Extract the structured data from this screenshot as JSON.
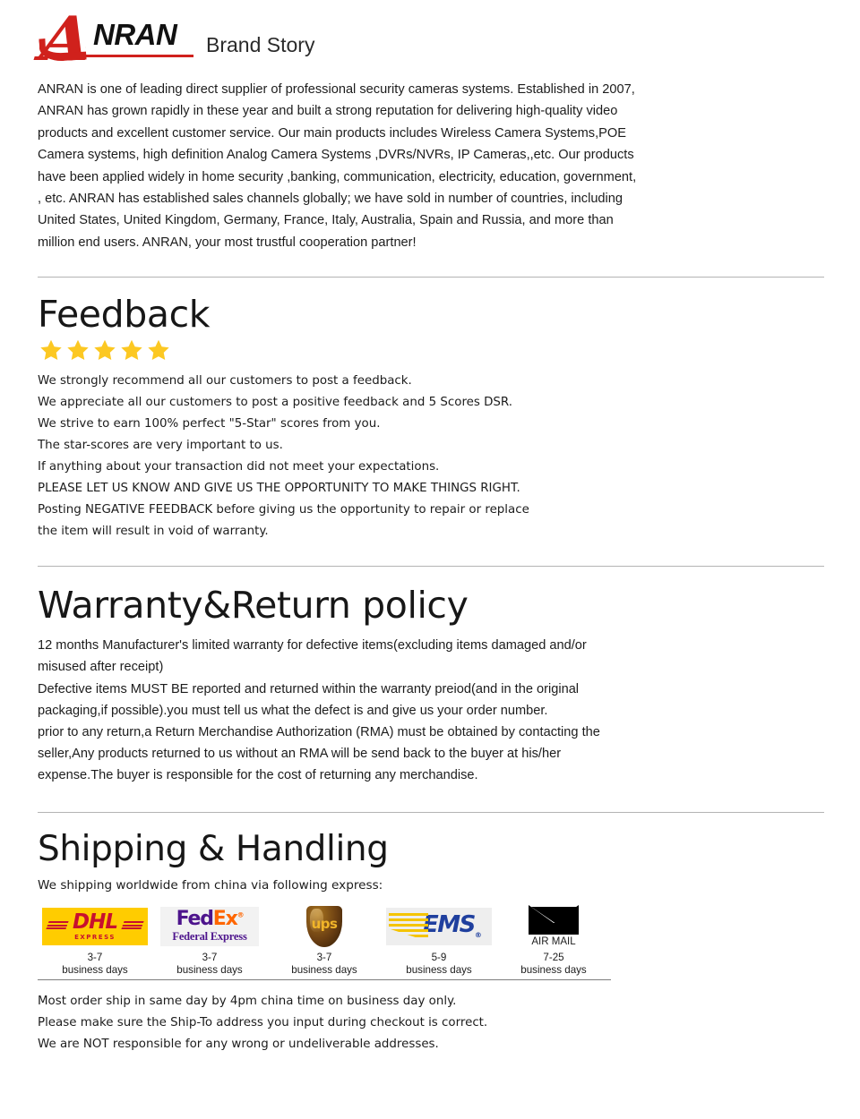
{
  "brand": {
    "logo_letter": "A",
    "logo_word": "NRAN",
    "title": "Brand Story"
  },
  "story": {
    "lines": [
      "ANRAN is one of leading direct supplier of professional security cameras systems. Established in 2007,",
      "ANRAN has grown rapidly in these year and built a strong reputation for delivering high-quality video",
      "products and excellent customer service. Our main products includes Wireless Camera Systems,POE",
      "Camera systems, high definition Analog Camera Systems ,DVRs/NVRs, IP Cameras,,etc. Our products",
      "have been applied widely in home security ,banking, communication, electricity, education, government,",
      ", etc. ANRAN has established sales channels globally; we have sold in number of countries, including",
      "United States, United Kingdom, Germany, France, Italy, Australia, Spain and Russia, and more than",
      "million end users. ANRAN, your most trustful cooperation partner!"
    ]
  },
  "feedback": {
    "heading": "Feedback",
    "star_count": 5,
    "star_color": "#fcc822",
    "lines": [
      "We strongly recommend all our customers to post a feedback.",
      "We appreciate all our customers to post a positive feedback and 5 Scores DSR.",
      "We strive to earn 100% perfect \"5-Star\" scores from you.",
      "The star-scores are very important to us.",
      "If anything about your transaction did not meet your expectations.",
      "PLEASE LET US KNOW AND GIVE US THE OPPORTUNITY TO MAKE THINGS RIGHT.",
      "Posting NEGATIVE FEEDBACK before giving us the opportunity to repair or replace",
      "the item will result in void of warranty."
    ]
  },
  "warranty": {
    "heading": "Warranty&Return policy",
    "lines": [
      "12 months Manufacturer's limited warranty for defective items(excluding items damaged and/or",
      "misused after receipt)",
      "Defective items MUST BE reported and returned within the warranty preiod(and in the original",
      "packaging,if possible).you must tell us what the defect is and give us your order number.",
      "prior to any return,a Return Merchandise Authorization (RMA) must be obtained by contacting the",
      "seller,Any products returned to us without an RMA will be send back to the buyer at his/her",
      "expense.The buyer is responsible for the cost of returning any merchandise."
    ]
  },
  "shipping": {
    "heading": "Shipping & Handling",
    "intro": "We shipping worldwide from china via following express:",
    "carriers": [
      {
        "name": "DHL",
        "logo": "dhl-logo",
        "word": "DHL",
        "sub": "EXPRESS",
        "days": "3-7",
        "days_unit": "business days"
      },
      {
        "name": "FedEx",
        "logo": "fedex-logo",
        "word_a": "Fed",
        "word_b": "Ex",
        "sub": "Federal Express",
        "days": "3-7",
        "days_unit": "business days"
      },
      {
        "name": "UPS",
        "logo": "ups-logo",
        "word": "ups",
        "days": "3-7",
        "days_unit": "business days"
      },
      {
        "name": "EMS",
        "logo": "ems-logo",
        "word": "EMS",
        "days": "5-9",
        "days_unit": "business days"
      },
      {
        "name": "Air Mail",
        "logo": "airmail-logo",
        "sub": "AIR MAIL",
        "days": "7-25",
        "days_unit": "business days"
      }
    ],
    "notes": [
      "Most order ship in same day by 4pm china time on business day only.",
      "Please make sure the Ship-To address you input during checkout is correct.",
      "We are NOT responsible for any wrong or undeliverable addresses."
    ]
  }
}
